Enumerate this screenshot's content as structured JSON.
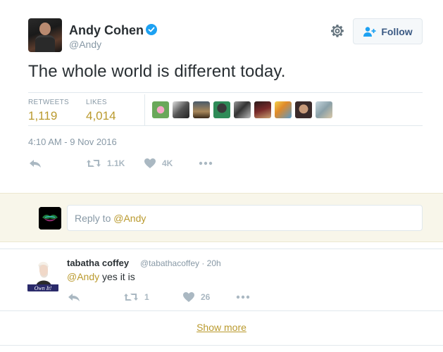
{
  "tweet": {
    "author_name": "Andy Cohen",
    "author_handle": "@Andy",
    "text": "The whole world is different today.",
    "follow_label": "Follow",
    "timestamp": "4:10 AM - 9 Nov 2016",
    "stats": {
      "retweets_label": "RETWEETS",
      "retweets_value": "1,119",
      "likes_label": "LIKES",
      "likes_value": "4,014"
    },
    "actions": {
      "retweet_count": "1.1K",
      "like_count": "4K"
    }
  },
  "reply_box": {
    "placeholder_prefix": "Reply to ",
    "placeholder_mention": "@Andy"
  },
  "replies": [
    {
      "author_name": "tabatha coffey",
      "author_handle": "@tabathacoffey · 20h",
      "mention": "@Andy",
      "text": " yes it is",
      "avatar_caption": "Own It!",
      "retweet_count": "1",
      "like_count": "26"
    }
  ],
  "show_more_label": "Show more",
  "colors": {
    "accent": "#ba9a2e",
    "verified": "#1da1f2",
    "follow_text": "#3b5a84",
    "muted": "#8899a6",
    "reply_bg": "#f8f6ea"
  }
}
